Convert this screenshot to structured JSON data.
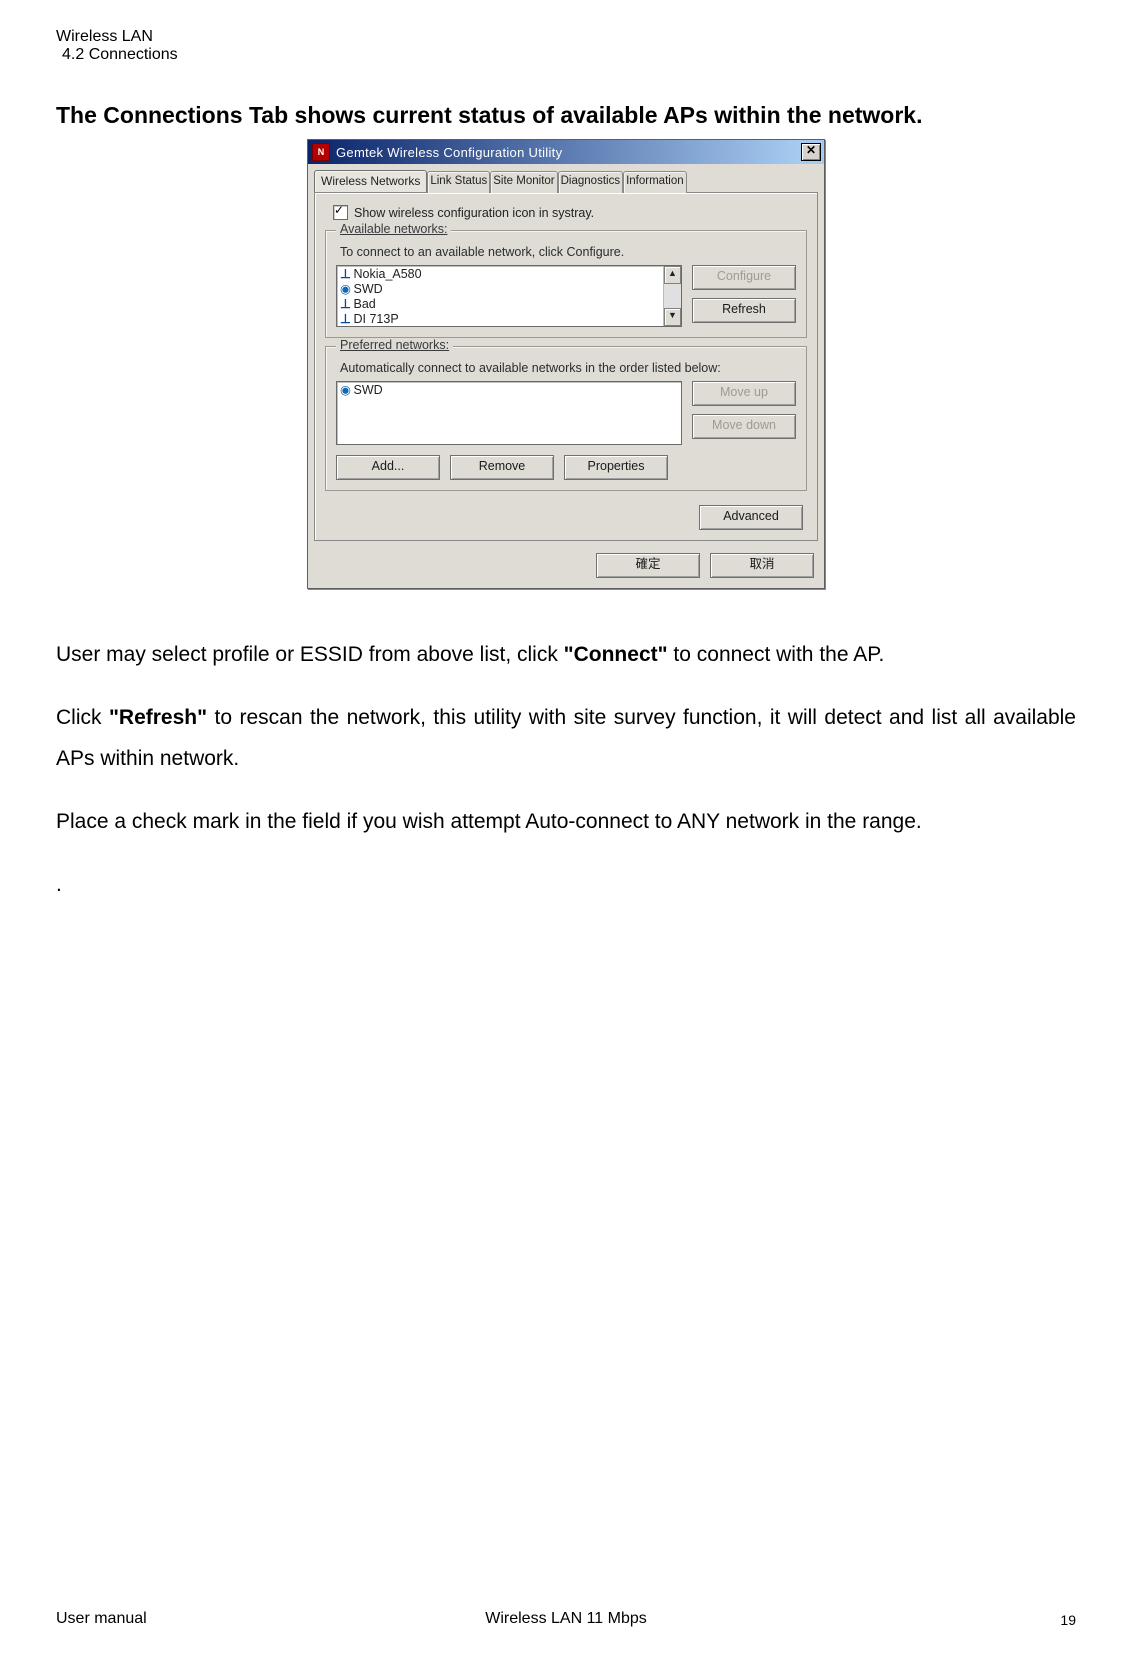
{
  "header": {
    "line1": "Wireless LAN",
    "line2": "4.2 Connections"
  },
  "heading": "The Connections Tab shows  current status of available APs within the network.",
  "dialog": {
    "icon_text": "N",
    "title": "Gemtek Wireless Configuration Utility",
    "close_symbol": "✕",
    "tabs": [
      "Wireless Networks",
      "Link Status",
      "Site Monitor",
      "Diagnostics",
      "Information"
    ],
    "active_tab_index": 0,
    "checkbox_label": "Show wireless configuration icon in systray.",
    "available": {
      "group_title": "Available networks:",
      "caption": "To connect to an available network, click Configure.",
      "items": [
        {
          "icon": "antenna",
          "label": "Nokia_A580"
        },
        {
          "icon": "globe",
          "label": "SWD"
        },
        {
          "icon": "antenna",
          "label": "Bad"
        },
        {
          "icon": "antenna",
          "label": "DI 713P"
        }
      ],
      "btn_configure": "Configure",
      "btn_refresh": "Refresh"
    },
    "preferred": {
      "group_title": "Preferred networks:",
      "caption": "Automatically connect to available networks in the order listed below:",
      "items": [
        {
          "icon": "globe",
          "label": "SWD"
        }
      ],
      "btn_moveup": "Move up",
      "btn_movedown": "Move down",
      "btn_add": "Add...",
      "btn_remove": "Remove",
      "btn_properties": "Properties"
    },
    "btn_advanced": "Advanced",
    "btn_ok": "確定",
    "btn_cancel": "取消"
  },
  "body": {
    "p1a": "User may select profile or ESSID from above list, click ",
    "p1b": "\"Connect\"",
    "p1c": " to connect with the AP.",
    "p2a": "Click ",
    "p2b": "\"Refresh\"",
    "p2c": " to rescan the network, this utility with site survey function, it will detect and list all available APs within network.",
    "p3": "Place a check mark in the field if you wish attempt Auto-connect to ANY network in the range.",
    "p4": "."
  },
  "footer": {
    "left": "User manual",
    "center": "Wireless LAN 11 Mbps",
    "right": "19"
  }
}
